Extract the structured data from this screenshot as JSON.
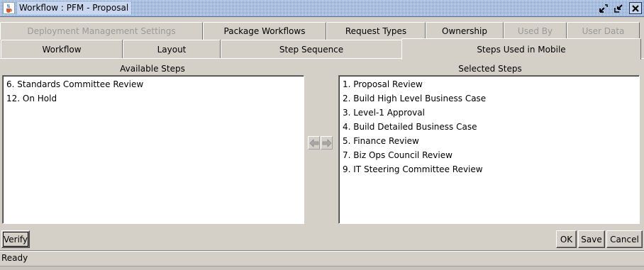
{
  "window": {
    "title": "Workflow : PFM - Proposal",
    "icon": "java-cup-icon",
    "controls": [
      "restore-icon",
      "restore-icon",
      "close-icon"
    ]
  },
  "tabs": {
    "row1": [
      {
        "label": "Deployment Management Settings",
        "enabled": false
      },
      {
        "label": "Package Workflows",
        "enabled": true
      },
      {
        "label": "Request Types",
        "enabled": true
      },
      {
        "label": "Ownership",
        "enabled": true
      },
      {
        "label": "Used By",
        "enabled": false
      },
      {
        "label": "User Data",
        "enabled": false
      }
    ],
    "row2": [
      {
        "label": "Workflow",
        "selected": false
      },
      {
        "label": "Layout",
        "selected": false
      },
      {
        "label": "Step Sequence",
        "selected": false
      },
      {
        "label": "Steps Used in Mobile",
        "selected": true
      }
    ]
  },
  "available": {
    "label": "Available Steps",
    "items": [
      "6. Standards Committee Review",
      "12. On Hold"
    ]
  },
  "selected": {
    "label": "Selected Steps",
    "items": [
      "1. Proposal Review",
      "2. Build High Level Business Case",
      "3. Level-1 Approval",
      "4. Build Detailed Business Case",
      "5. Finance Review",
      "7. Biz Ops Council Review",
      "9. IT Steering Committee Review"
    ]
  },
  "move_buttons": [
    "arrow-left-icon",
    "arrow-right-icon"
  ],
  "footer": {
    "verify_label": "Verify",
    "ok_label": "OK",
    "save_label": "Save",
    "cancel_label": "Cancel"
  },
  "status": "Ready",
  "colors": {
    "background": "#d4d0c8",
    "title_bar": "#5b84c8",
    "disabled_text": "#9a9a9a"
  }
}
